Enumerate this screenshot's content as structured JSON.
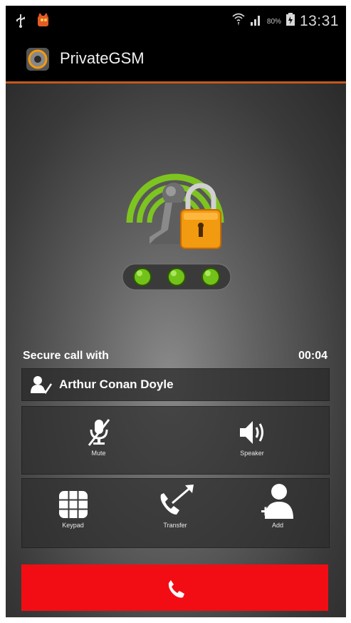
{
  "status_bar": {
    "time": "13:31",
    "battery_percent": "80%"
  },
  "app": {
    "title": "PrivateGSM"
  },
  "call": {
    "secure_label": "Secure call with",
    "timer": "00:04",
    "contact_name": "Arthur Conan Doyle",
    "security_level": 3
  },
  "controls": {
    "mute": "Mute",
    "speaker": "Speaker",
    "keypad": "Keypad",
    "transfer": "Transfer",
    "add": "Add"
  },
  "colors": {
    "accent_line": "#c4591c",
    "end_call": "#f20d14",
    "signal_green": "#7ec420",
    "lock_orange": "#f29a10"
  }
}
